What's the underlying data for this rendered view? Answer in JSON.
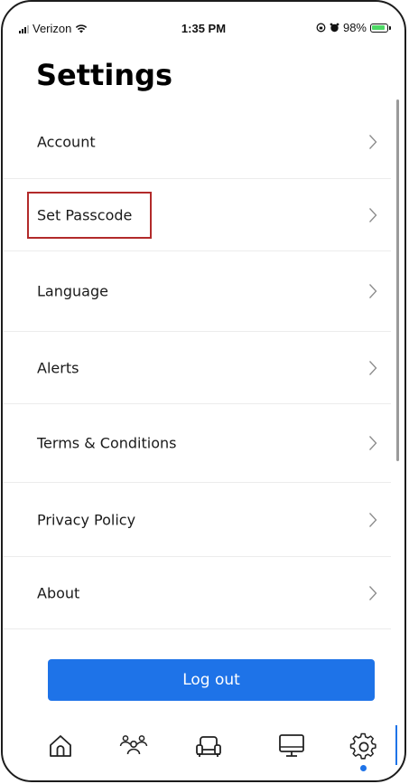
{
  "status_bar": {
    "carrier": "Verizon",
    "time": "1:35 PM",
    "battery_text": "98%",
    "battery_level": 0.98
  },
  "title": "Settings",
  "items": [
    {
      "label": "Account"
    },
    {
      "label": "Set Passcode"
    },
    {
      "label": "Language"
    },
    {
      "label": "Alerts"
    },
    {
      "label": "Terms & Conditions"
    },
    {
      "label": "Privacy Policy"
    },
    {
      "label": "About"
    }
  ],
  "logout_label": "Log out",
  "tabs": [
    {
      "icon": "home-icon"
    },
    {
      "icon": "people-icon"
    },
    {
      "icon": "sofa-icon"
    },
    {
      "icon": "monitor-icon"
    },
    {
      "icon": "gear-icon",
      "active": true
    }
  ],
  "colors": {
    "accent": "#1e73e8",
    "highlight": "#b22a2a"
  }
}
